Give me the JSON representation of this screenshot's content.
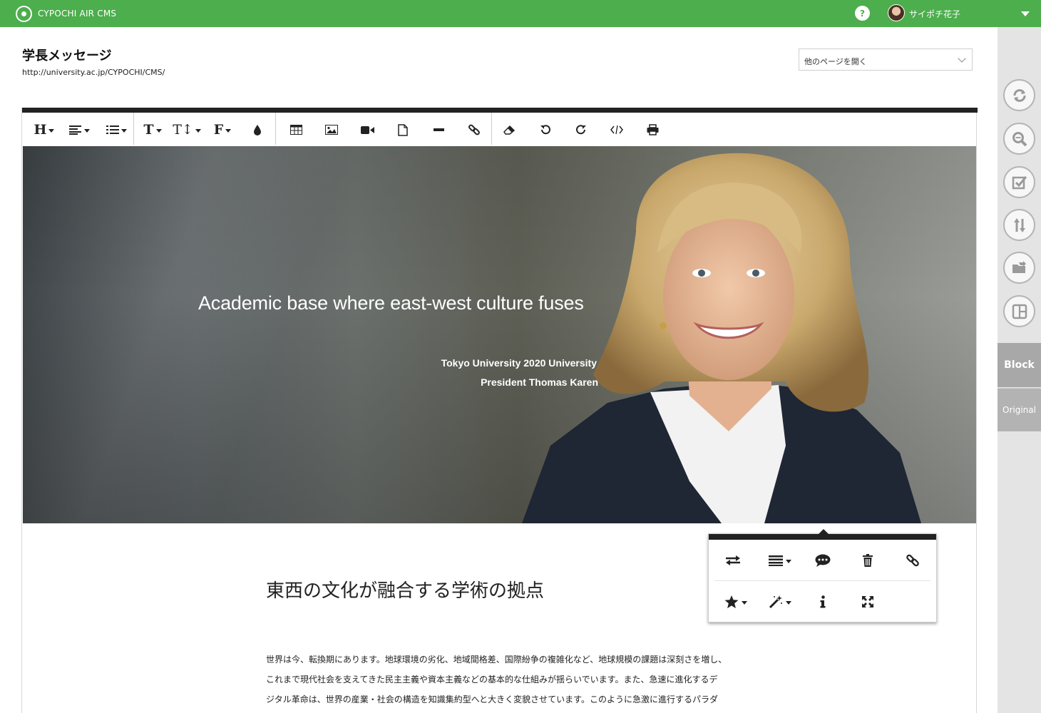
{
  "app": {
    "title": "CYPOCHI AIR CMS",
    "help_label": "?"
  },
  "user": {
    "name": "サイポチ花子"
  },
  "page": {
    "title": "学長メッセージ",
    "url": "http://university.ac.jp/CYPOCHI/CMS/",
    "open_other_placeholder": "他のページを開く"
  },
  "toolbar": {
    "heading": "H",
    "text_style": "T",
    "text_size": "T↕",
    "font": "F"
  },
  "hero": {
    "headline": "Academic base where east-west culture fuses",
    "subtitle_1": "Tokyo University 2020 University",
    "subtitle_2": "President Thomas Karen"
  },
  "content": {
    "heading": "東西の文化が融合する学術の拠点",
    "paragraph_lines": [
      "世界は今、転換期にあります。地球環境の劣化、地域間格差、国際紛争の複雑化など、地球規模の課題は深刻さを増し、",
      "これまで現代社会を支えてきた民主主義や資本主義などの基本的な仕組みが揺らいでいます。また、急速に進化するデ",
      "ジタル革命は、世界の産業・社会の構造を知識集約型へと大きく変貌させています。このように急激に進行するパラダ"
    ]
  },
  "sidebar": {
    "tab_block": "Block",
    "tab_original": "Original",
    "buttons": [
      "refresh-icon",
      "preview-zoom-icon",
      "approve-checkbox-icon",
      "sort-updown-icon",
      "folder-open-icon",
      "layout-icon"
    ]
  },
  "colors": {
    "brand_green": "#4cae4c",
    "toolbar_black": "#222222",
    "sidebar_gray": "#e4e4e4"
  }
}
